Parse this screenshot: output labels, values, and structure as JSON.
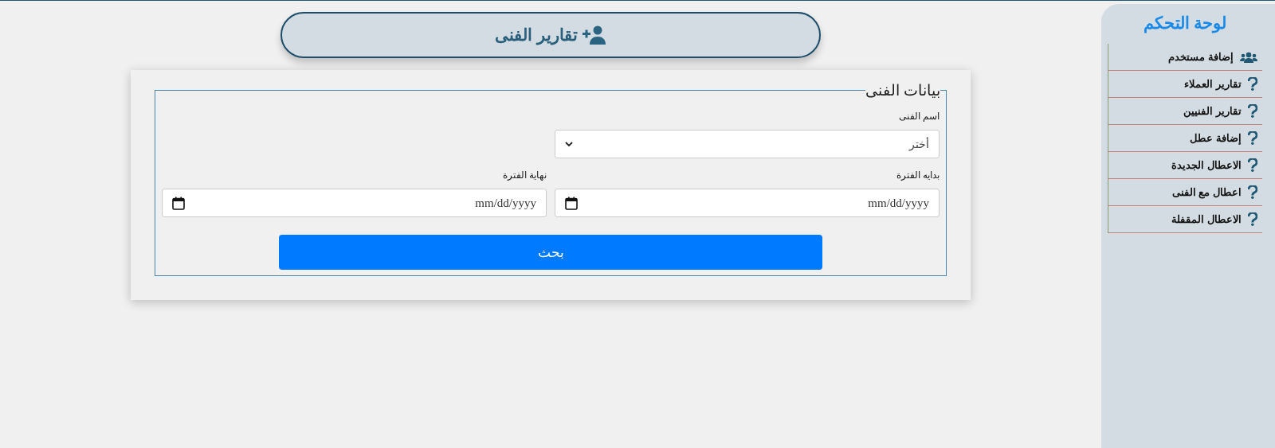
{
  "header": {
    "title": "تقارير الفنى"
  },
  "sidebar": {
    "title": "لوحة التحكم",
    "items": [
      {
        "label": "إضافة مستخدم",
        "kind": "users"
      },
      {
        "label": "تقارير العملاء",
        "kind": "help"
      },
      {
        "label": "تقارير الفنيين",
        "kind": "help"
      },
      {
        "label": "إضافة عطل",
        "kind": "help"
      },
      {
        "label": "الاعطال الجديدة",
        "kind": "help"
      },
      {
        "label": "اعطال مع الفنى",
        "kind": "help"
      },
      {
        "label": "الاعطال المقفلة",
        "kind": "help"
      }
    ]
  },
  "form": {
    "legend": "بيانات الفنى",
    "technician": {
      "label": "اسم الفنى",
      "value": "أختر"
    },
    "start": {
      "label": "بدايه الفترة",
      "placeholder": "mm/dd/yyyy"
    },
    "end": {
      "label": "نهاية الفترة",
      "placeholder": "mm/dd/yyyy"
    },
    "submit": "بحث"
  }
}
